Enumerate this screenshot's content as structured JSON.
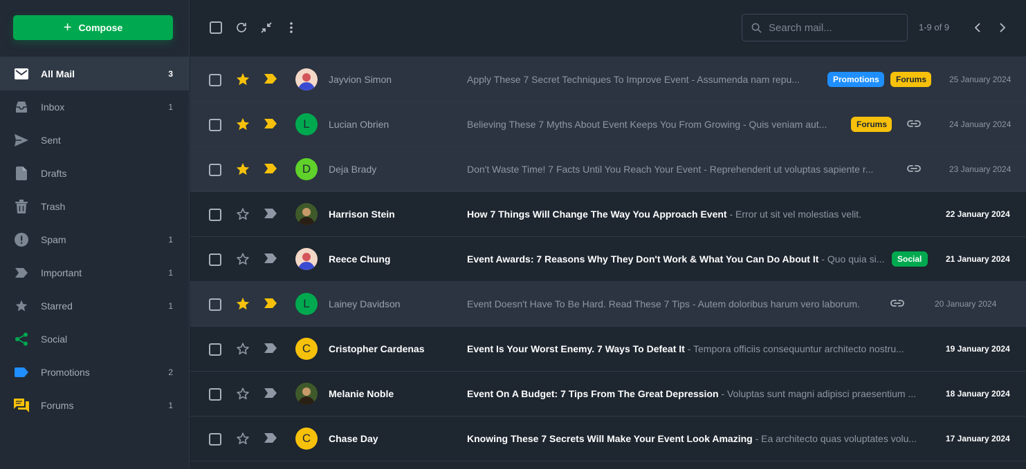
{
  "sidebar": {
    "compose_label": "Compose",
    "items": [
      {
        "label": "All Mail",
        "count": "3",
        "icon": "mail-icon"
      },
      {
        "label": "Inbox",
        "count": "1",
        "icon": "inbox-icon"
      },
      {
        "label": "Sent",
        "count": "",
        "icon": "send-icon"
      },
      {
        "label": "Drafts",
        "count": "",
        "icon": "draft-icon"
      },
      {
        "label": "Trash",
        "count": "",
        "icon": "trash-icon"
      },
      {
        "label": "Spam",
        "count": "1",
        "icon": "spam-icon"
      },
      {
        "label": "Important",
        "count": "1",
        "icon": "important-icon"
      },
      {
        "label": "Starred",
        "count": "1",
        "icon": "star-icon"
      },
      {
        "label": "Social",
        "count": "",
        "icon": "share-icon"
      },
      {
        "label": "Promotions",
        "count": "2",
        "icon": "tag-icon"
      },
      {
        "label": "Forums",
        "count": "1",
        "icon": "forum-icon"
      }
    ]
  },
  "toolbar": {
    "search_placeholder": "Search mail...",
    "pager": "1-9 of 9"
  },
  "colors": {
    "accent_green": "#00a94f",
    "star_yellow": "#f7c10b",
    "promotions_blue": "#1f8fff"
  },
  "emails": [
    {
      "sender": "Jayvion Simon",
      "subject": "Apply These 7 Secret Techniques To Improve Event",
      "snippet": " - Assumenda nam repu...",
      "date": "25 January 2024",
      "read": true,
      "starred": true,
      "important": true,
      "tags": [
        "Promotions",
        "Forums"
      ],
      "attachment": false,
      "avatar": "photo"
    },
    {
      "sender": "Lucian Obrien",
      "subject": "Believing These 7 Myths About Event Keeps You From Growing",
      "snippet": " - Quis veniam aut...",
      "date": "24 January 2024",
      "read": true,
      "starred": true,
      "important": true,
      "tags": [
        "Forums"
      ],
      "attachment": true,
      "avatar": "L"
    },
    {
      "sender": "Deja Brady",
      "subject": "Don't Waste Time! 7 Facts Until You Reach Your Event",
      "snippet": " - Reprehenderit ut voluptas sapiente r...",
      "date": "23 January 2024",
      "read": true,
      "starred": true,
      "important": true,
      "tags": [],
      "attachment": true,
      "avatar": "D"
    },
    {
      "sender": "Harrison Stein",
      "subject": "How 7 Things Will Change The Way You Approach Event",
      "snippet": " - Error ut sit vel molestias velit.",
      "date": "22 January 2024",
      "read": false,
      "starred": false,
      "important": false,
      "tags": [],
      "attachment": false,
      "avatar": "photo"
    },
    {
      "sender": "Reece Chung",
      "subject": "Event Awards: 7 Reasons Why They Don't Work & What You Can Do About It",
      "snippet": " - Quo quia si...",
      "date": "21 January 2024",
      "read": false,
      "starred": false,
      "important": false,
      "tags": [
        "Social"
      ],
      "attachment": false,
      "avatar": "photo"
    },
    {
      "sender": "Lainey Davidson",
      "subject": "Event Doesn't Have To Be Hard. Read These 7 Tips",
      "snippet": " - Autem doloribus harum vero laborum.",
      "date": "20 January 2024",
      "read": true,
      "starred": true,
      "important": true,
      "tags": [],
      "attachment": true,
      "avatar": "L"
    },
    {
      "sender": "Cristopher Cardenas",
      "subject": "Event Is Your Worst Enemy. 7 Ways To Defeat It",
      "snippet": " - Tempora officiis consequuntur architecto nostru...",
      "date": "19 January 2024",
      "read": false,
      "starred": false,
      "important": false,
      "tags": [],
      "attachment": false,
      "avatar": "C"
    },
    {
      "sender": "Melanie Noble",
      "subject": "Event On A Budget: 7 Tips From The Great Depression",
      "snippet": " - Voluptas sunt magni adipisci praesentium ...",
      "date": "18 January 2024",
      "read": false,
      "starred": false,
      "important": false,
      "tags": [],
      "attachment": false,
      "avatar": "photo"
    },
    {
      "sender": "Chase Day",
      "subject": "Knowing These 7 Secrets Will Make Your Event Look Amazing",
      "snippet": " - Ea architecto quas voluptates volu...",
      "date": "17 January 2024",
      "read": false,
      "starred": false,
      "important": false,
      "tags": [],
      "attachment": false,
      "avatar": "C"
    }
  ]
}
